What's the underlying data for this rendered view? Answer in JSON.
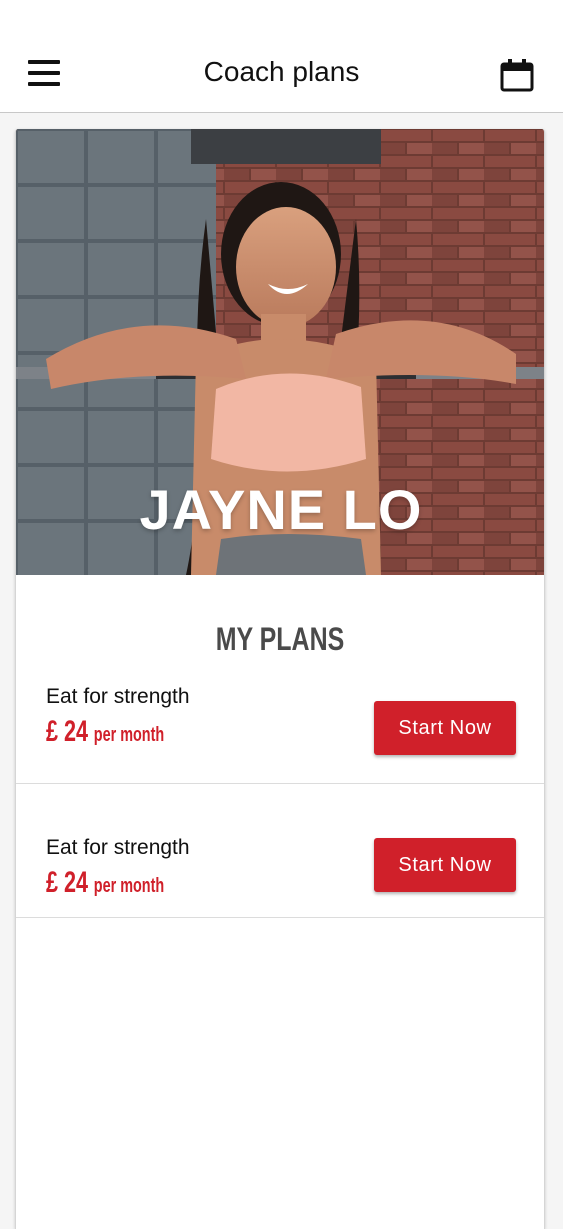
{
  "header": {
    "title": "Coach plans",
    "menu_icon": "menu-icon",
    "calendar_icon": "calendar-icon"
  },
  "coach": {
    "name": "JAYNE LO"
  },
  "plans_section": {
    "title": "MY PLANS",
    "plans": [
      {
        "name": "Eat for strength",
        "price": "£ 24",
        "period": "per month",
        "button_label": "Start Now"
      },
      {
        "name": "Eat for strength",
        "price": "£ 24",
        "period": "per month",
        "button_label": "Start Now"
      }
    ]
  },
  "colors": {
    "accent": "#d0202a",
    "background": "#f5f5f5",
    "header_bg": "#ffffff"
  }
}
